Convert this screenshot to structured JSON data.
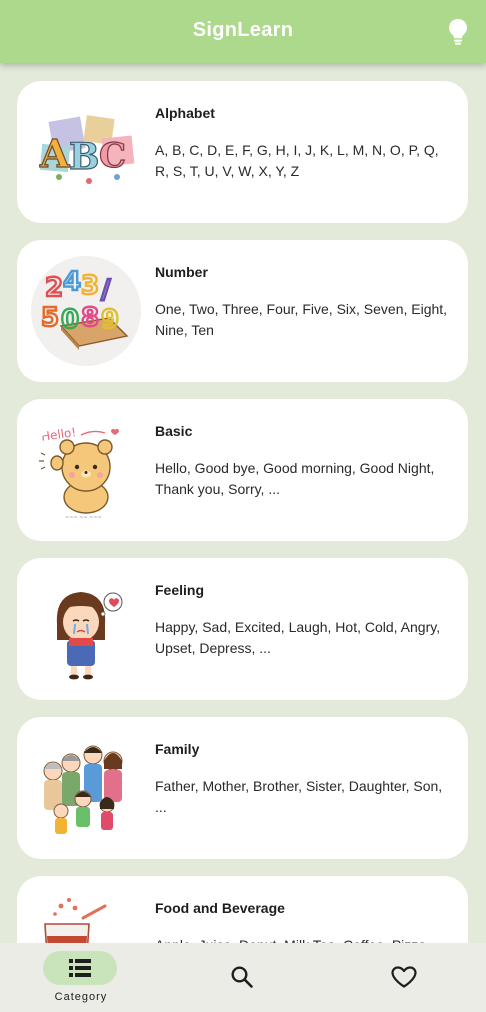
{
  "appbar": {
    "title": "SignLearn",
    "action_icon": "lightbulb-icon"
  },
  "categories": [
    {
      "title": "Alphabet",
      "description": "A, B, C, D, E, F, G, H, I, J, K, L, M, N, O, P, Q, R, S, T, U, V, W, X, Y, Z",
      "icon": "abc-blocks-image"
    },
    {
      "title": "Number",
      "description": "One, Two, Three, Four, Five, Six, Seven, Eight, Nine, Ten",
      "icon": "numbers-book-image"
    },
    {
      "title": "Basic",
      "description": "Hello, Good bye, Good morning, Good Night, Thank you, Sorry, ...",
      "icon": "hello-bear-image"
    },
    {
      "title": "Feeling",
      "description": "Happy, Sad, Excited, Laugh, Hot, Cold, Angry, Upset, Depress, ...",
      "icon": "crying-girl-image"
    },
    {
      "title": "Family",
      "description": "Father, Mother, Brother, Sister, Daughter, Son, ...",
      "icon": "family-group-image"
    },
    {
      "title": "Food and Beverage",
      "description": "Apple, Juice, Donut, Milk Tea, Coffee, Pizza, ...",
      "icon": "drink-food-image"
    }
  ],
  "bottom_nav": {
    "category_label": "Category",
    "items": [
      "list-icon",
      "search-icon",
      "heart-icon"
    ]
  },
  "colors": {
    "appbar": "#acd98b",
    "background": "#e4ead9",
    "card": "#ffffff",
    "nav_pill": "#c9e4ba"
  }
}
